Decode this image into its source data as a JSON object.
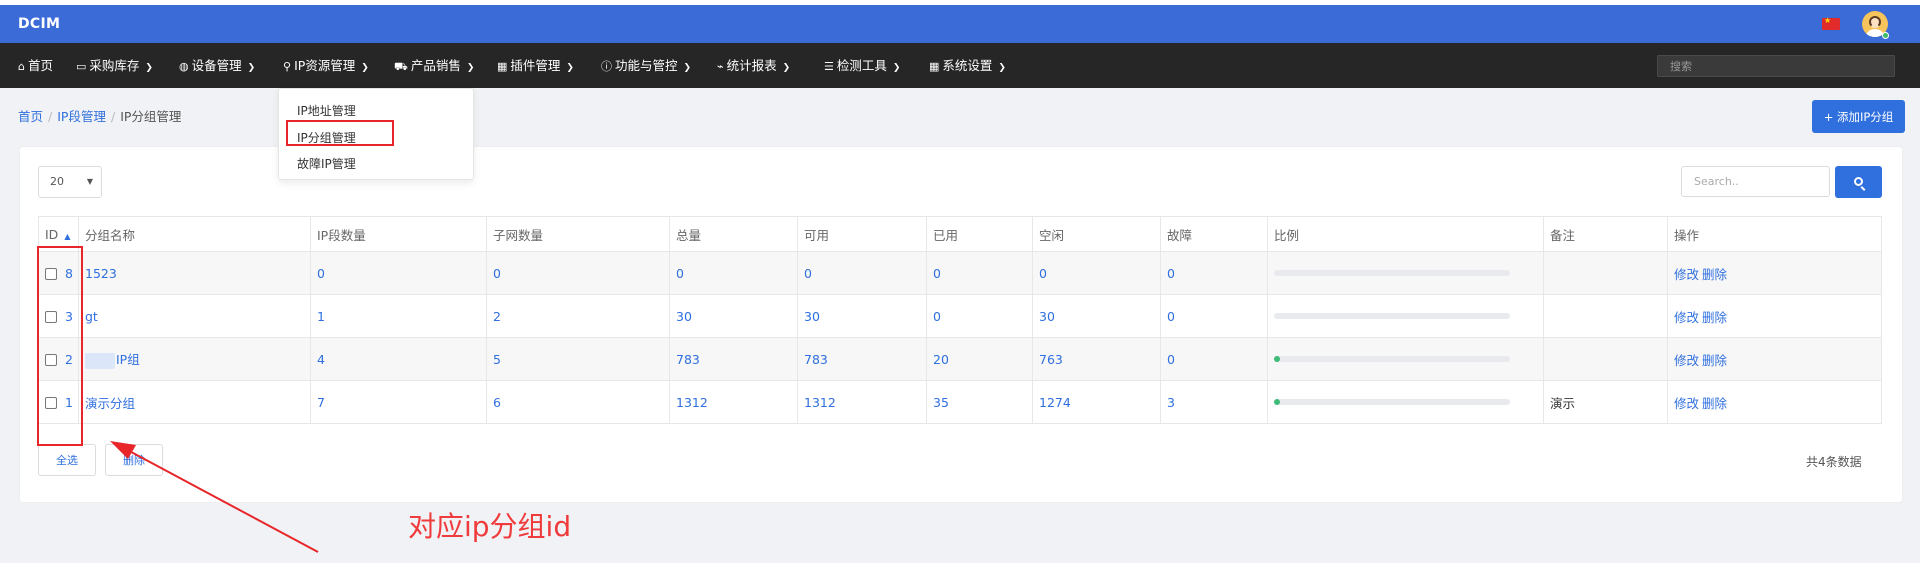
{
  "app": {
    "brand": "DCIM"
  },
  "nav": {
    "items": [
      {
        "label": "首页",
        "icon": "home-icon",
        "glyph": "⌂"
      },
      {
        "label": "采购库存",
        "icon": "box-icon",
        "glyph": "▭"
      },
      {
        "label": "设备管理",
        "icon": "shield-icon",
        "glyph": "◍"
      },
      {
        "label": "IP资源管理",
        "icon": "pin-icon",
        "glyph": "⚲"
      },
      {
        "label": "产品销售",
        "icon": "cart-icon",
        "glyph": "⛟"
      },
      {
        "label": "插件管理",
        "icon": "grid-icon",
        "glyph": "▦"
      },
      {
        "label": "功能与管控",
        "icon": "info-icon",
        "glyph": "ⓘ"
      },
      {
        "label": "统计报表",
        "icon": "chart-icon",
        "glyph": "⌁"
      },
      {
        "label": "检测工具",
        "icon": "list-icon",
        "glyph": "☰"
      },
      {
        "label": "系统设置",
        "icon": "grid-icon",
        "glyph": "▦"
      }
    ],
    "search_placeholder": "搜索"
  },
  "dropdown": {
    "items": [
      "IP地址管理",
      "IP分组管理",
      "故障IP管理"
    ]
  },
  "breadcrumb": [
    "首页",
    "IP段管理",
    "IP分组管理"
  ],
  "add_button": "+ 添加IP分组",
  "page_size": "20",
  "search": {
    "placeholder": "Search.."
  },
  "table": {
    "headers": [
      "ID",
      "分组名称",
      "IP段数量",
      "子网数量",
      "总量",
      "可用",
      "已用",
      "空闲",
      "故障",
      "比例",
      "备注",
      "操作"
    ],
    "rows": [
      {
        "id": "8",
        "name": "1523",
        "segments": "0",
        "subnets": "0",
        "total": "0",
        "available": "0",
        "used": "0",
        "free": "0",
        "fault": "0",
        "ratio": 0,
        "note": "",
        "edit": "修改",
        "del": "删除"
      },
      {
        "id": "3",
        "name": "gt",
        "segments": "1",
        "subnets": "2",
        "total": "30",
        "available": "30",
        "used": "0",
        "free": "30",
        "fault": "0",
        "ratio": 0,
        "note": "",
        "edit": "修改",
        "del": "删除"
      },
      {
        "id": "2",
        "name": "IP组",
        "segments": "4",
        "subnets": "5",
        "total": "783",
        "available": "783",
        "used": "20",
        "free": "763",
        "fault": "0",
        "ratio": 0.026,
        "note": "",
        "edit": "修改",
        "del": "删除"
      },
      {
        "id": "1",
        "name": "演示分组",
        "segments": "7",
        "subnets": "6",
        "total": "1312",
        "available": "1312",
        "used": "35",
        "free": "1274",
        "fault": "3",
        "ratio": 0.027,
        "note": "演示",
        "edit": "修改",
        "del": "删除"
      }
    ]
  },
  "footer": {
    "select_all": "全选",
    "delete": "删除",
    "total": "共4条数据"
  },
  "annotation": {
    "text": "对应ip分组id"
  },
  "colors": {
    "topbar": "#3b6bd6",
    "navbar": "#262626",
    "accent": "#2f6fde",
    "annotation": "#e8262a",
    "progress": "#3dbb78"
  }
}
